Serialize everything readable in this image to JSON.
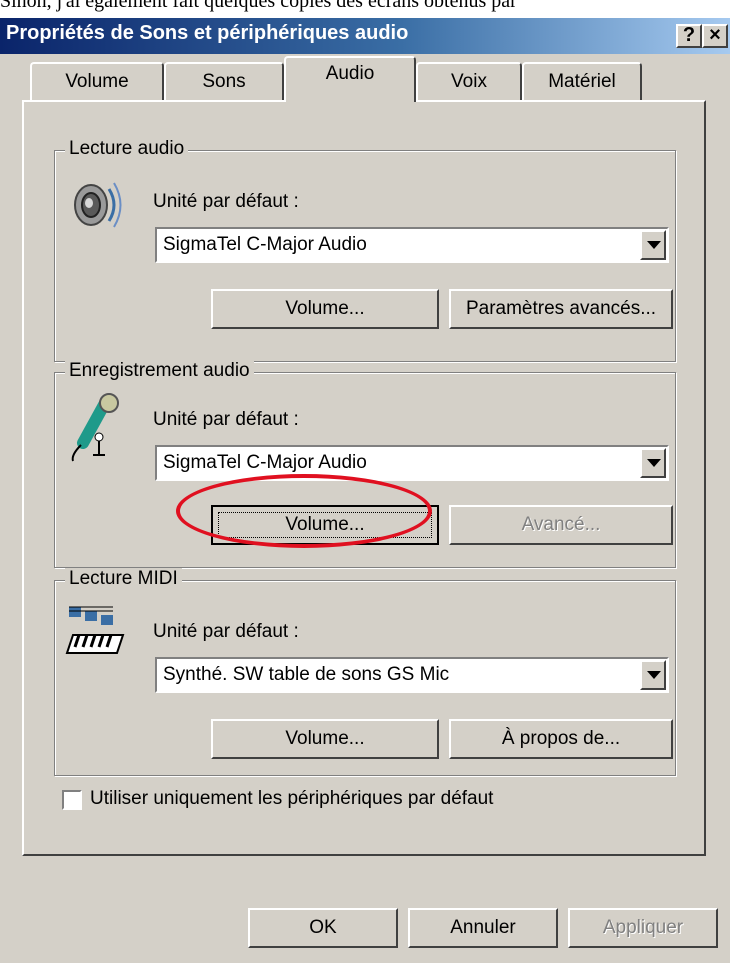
{
  "caption": "Sinon, j'ai également fait quelques copies des écrans obtenus par",
  "window": {
    "title": "Propriétés de Sons et périphériques audio",
    "help_btn": "?",
    "close_btn": "×"
  },
  "tabs": [
    {
      "label": "Volume"
    },
    {
      "label": "Sons"
    },
    {
      "label": "Audio",
      "active": true
    },
    {
      "label": "Voix"
    },
    {
      "label": "Matériel"
    }
  ],
  "playback": {
    "group_title": "Lecture audio",
    "icon": "speaker-icon",
    "default_label": "Unité par défaut :",
    "device": "SigmaTel C-Major Audio",
    "volume_btn": "Volume...",
    "advanced_btn": "Paramètres avancés..."
  },
  "recording": {
    "group_title": "Enregistrement audio",
    "icon": "microphone-icon",
    "default_label": "Unité par défaut :",
    "device": "SigmaTel C-Major Audio",
    "volume_btn": "Volume...",
    "advanced_btn": "Avancé..."
  },
  "midi": {
    "group_title": "Lecture MIDI",
    "icon": "keyboard-icon",
    "default_label": "Unité par défaut :",
    "device": "Synthé. SW table de sons GS Mic",
    "volume_btn": "Volume...",
    "about_btn": "À propos de..."
  },
  "use_default_only": {
    "label": "Utiliser uniquement les périphériques par défaut",
    "checked": false
  },
  "footer": {
    "ok": "OK",
    "cancel": "Annuler",
    "apply": "Appliquer"
  },
  "annotation_color": "#e01020"
}
